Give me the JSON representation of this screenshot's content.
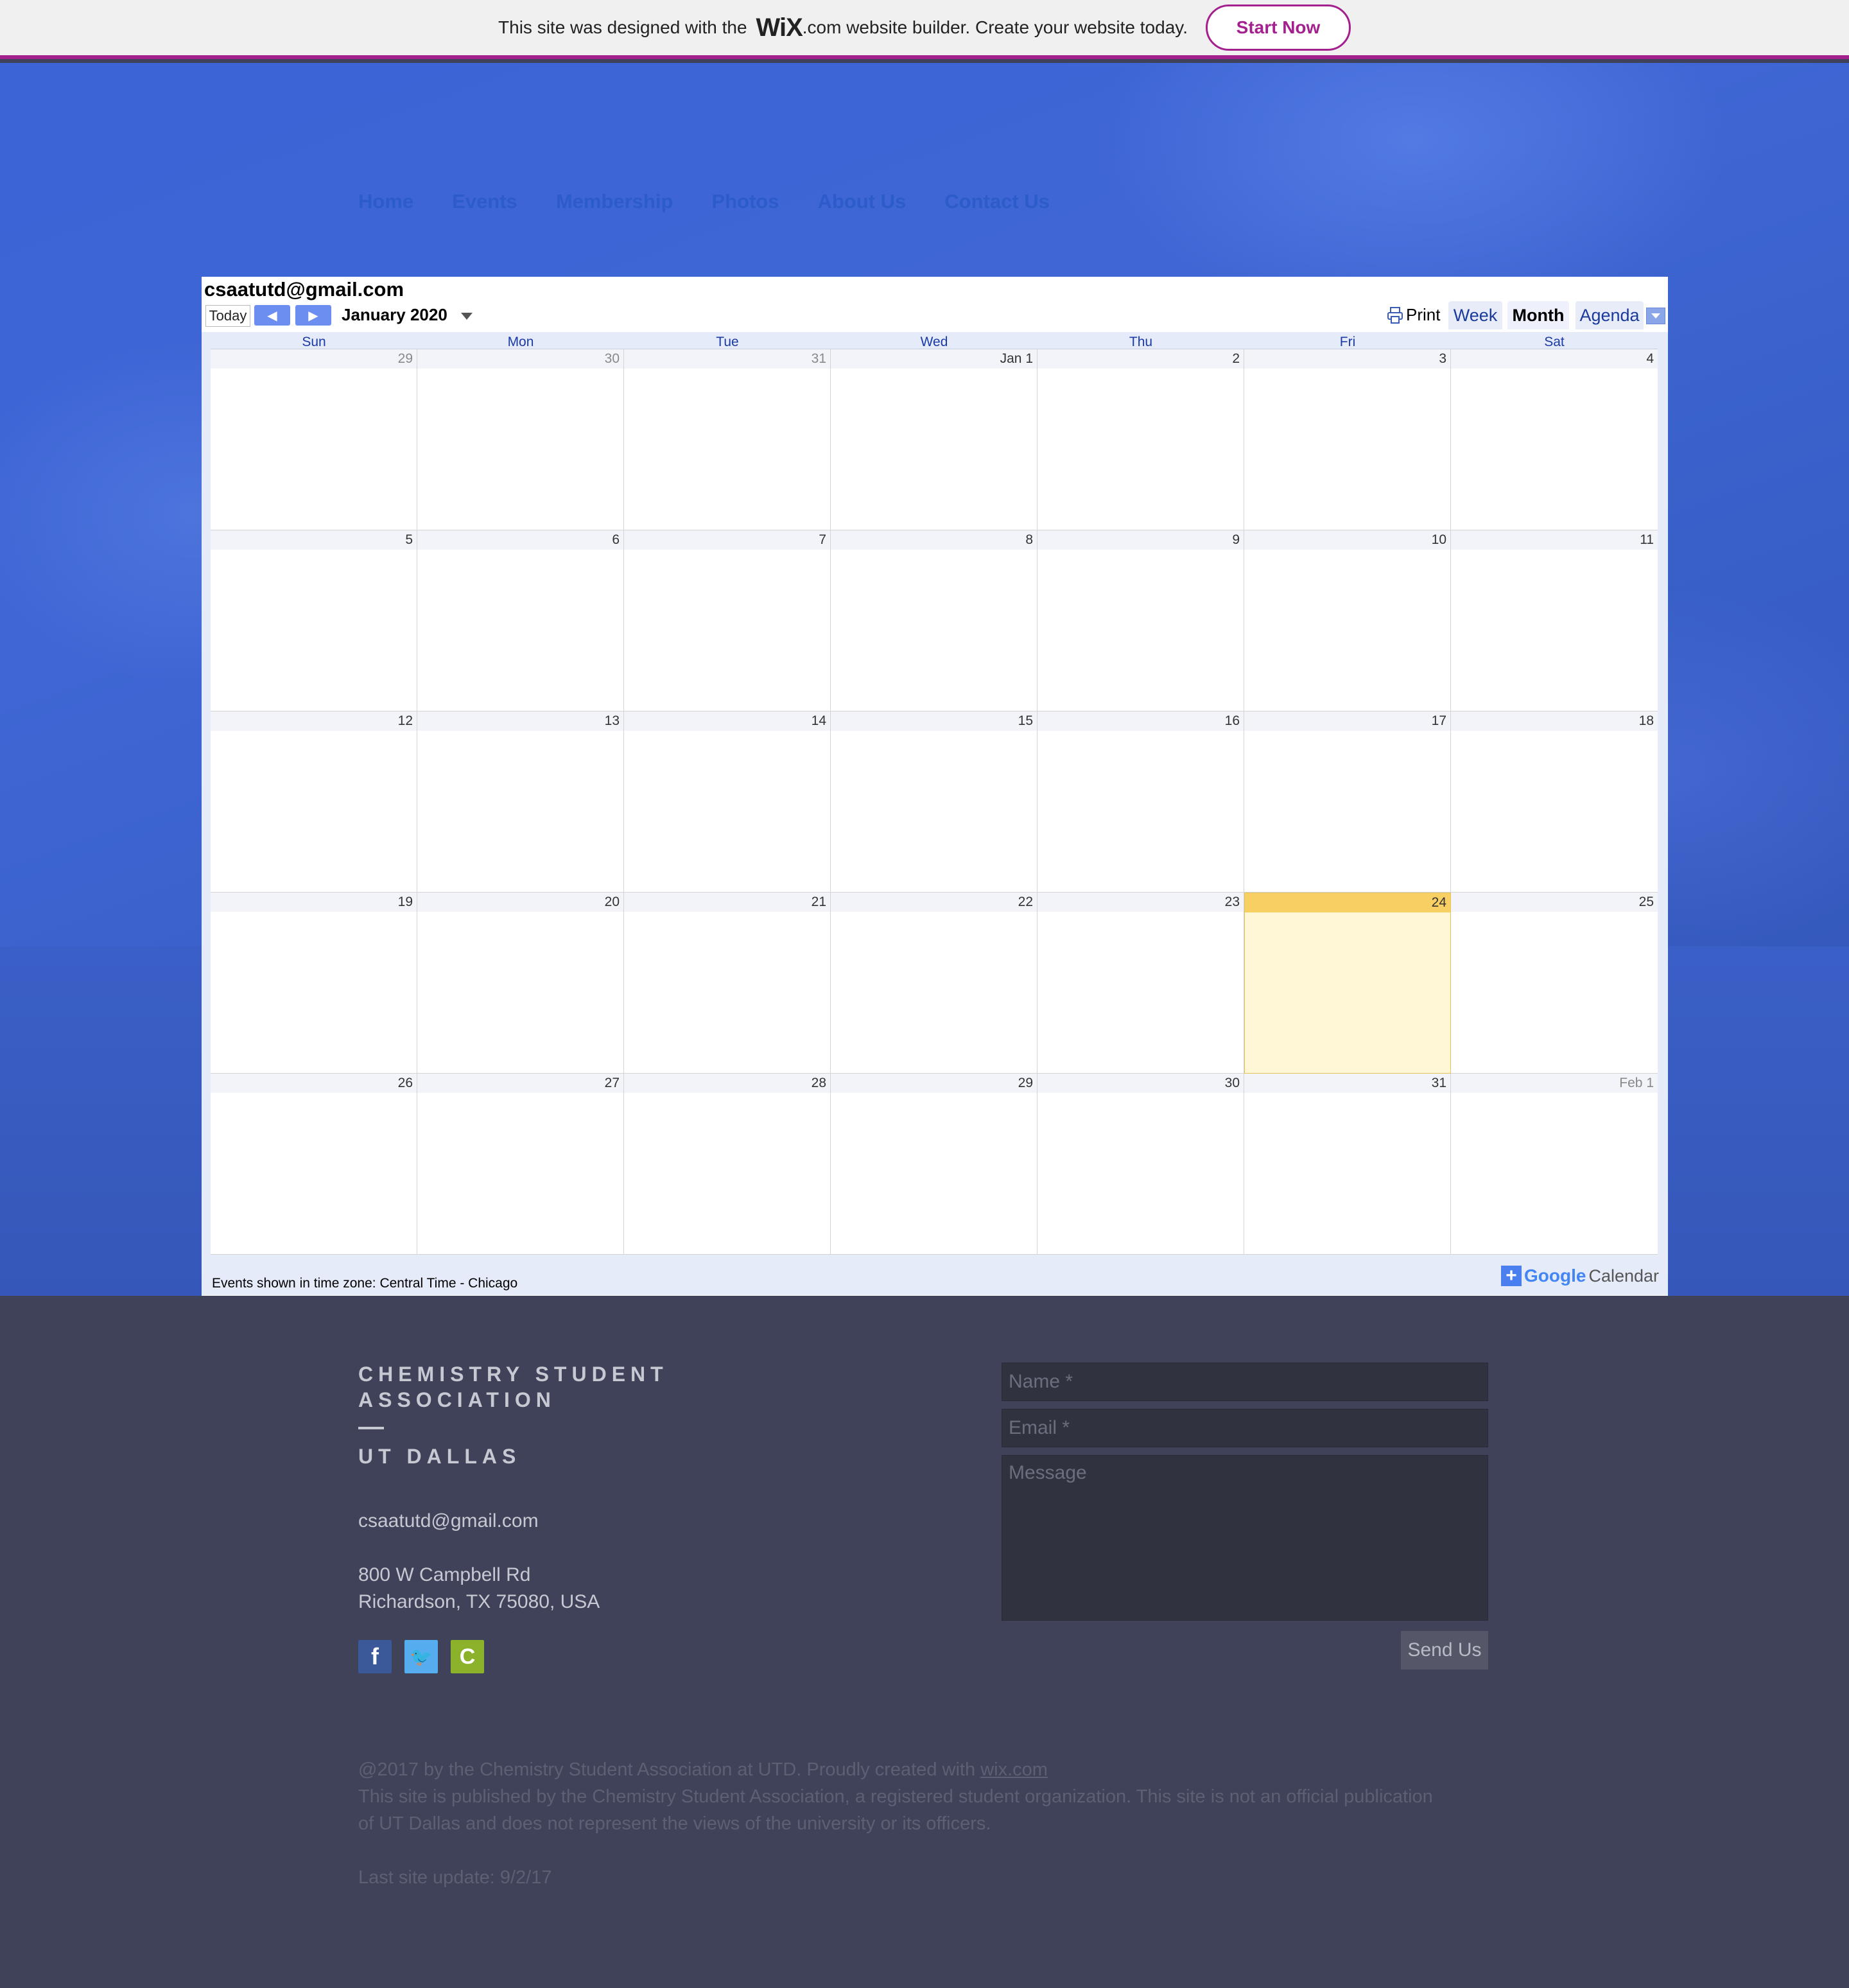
{
  "banner": {
    "prefix": "This site was designed with the",
    "logo": "WiX",
    "suffix": ".com website builder. Create your website today.",
    "start_label": "Start Now"
  },
  "nav": {
    "items": [
      "Home",
      "Events",
      "Membership",
      "Photos",
      "About Us",
      "Contact Us"
    ]
  },
  "calendar": {
    "owner": "csaatutd@gmail.com",
    "today_label": "Today",
    "title": "January 2020",
    "print_label": "Print",
    "tabs": [
      "Week",
      "Month",
      "Agenda"
    ],
    "active_tab": "Month",
    "days_of_week": [
      "Sun",
      "Mon",
      "Tue",
      "Wed",
      "Thu",
      "Fri",
      "Sat"
    ],
    "weeks": [
      [
        "29",
        "30",
        "31",
        "Jan 1",
        "2",
        "3",
        "4"
      ],
      [
        "5",
        "6",
        "7",
        "8",
        "9",
        "10",
        "11"
      ],
      [
        "12",
        "13",
        "14",
        "15",
        "16",
        "17",
        "18"
      ],
      [
        "19",
        "20",
        "21",
        "22",
        "23",
        "24",
        "25"
      ],
      [
        "26",
        "27",
        "28",
        "29",
        "30",
        "31",
        "Feb 1"
      ]
    ],
    "today": "24",
    "timezone": "Events shown in time zone: Central Time - Chicago",
    "badge_google": "Google",
    "badge_calendar": "Calendar",
    "today_color": "#f8cf63"
  },
  "footer": {
    "org_line1": "CHEMISTRY STUDENT",
    "org_line2": "ASSOCIATION",
    "org_line3": "UT DALLAS",
    "email": "csaatutd@gmail.com",
    "address1": "800 W Campbell Rd",
    "address2": "Richardson, TX 75080, USA",
    "social": [
      "facebook-icon",
      "twitter-icon",
      "chemistry-icon"
    ],
    "form": {
      "name_placeholder": "Name *",
      "email_placeholder": "Email *",
      "message_placeholder": "Message",
      "send_label": "Send Us"
    },
    "copy_prefix": "@2017 by the Chemistry Student Association at UTD. Proudly created with ",
    "copy_link": "wix.com",
    "copy2": "This site is published by the Chemistry Student Association, a registered student organization. This site is not an official publication",
    "copy3": "of UT Dallas and does not represent the views of the university or its officers.",
    "last_update": "Last site update: 9/2/17"
  }
}
